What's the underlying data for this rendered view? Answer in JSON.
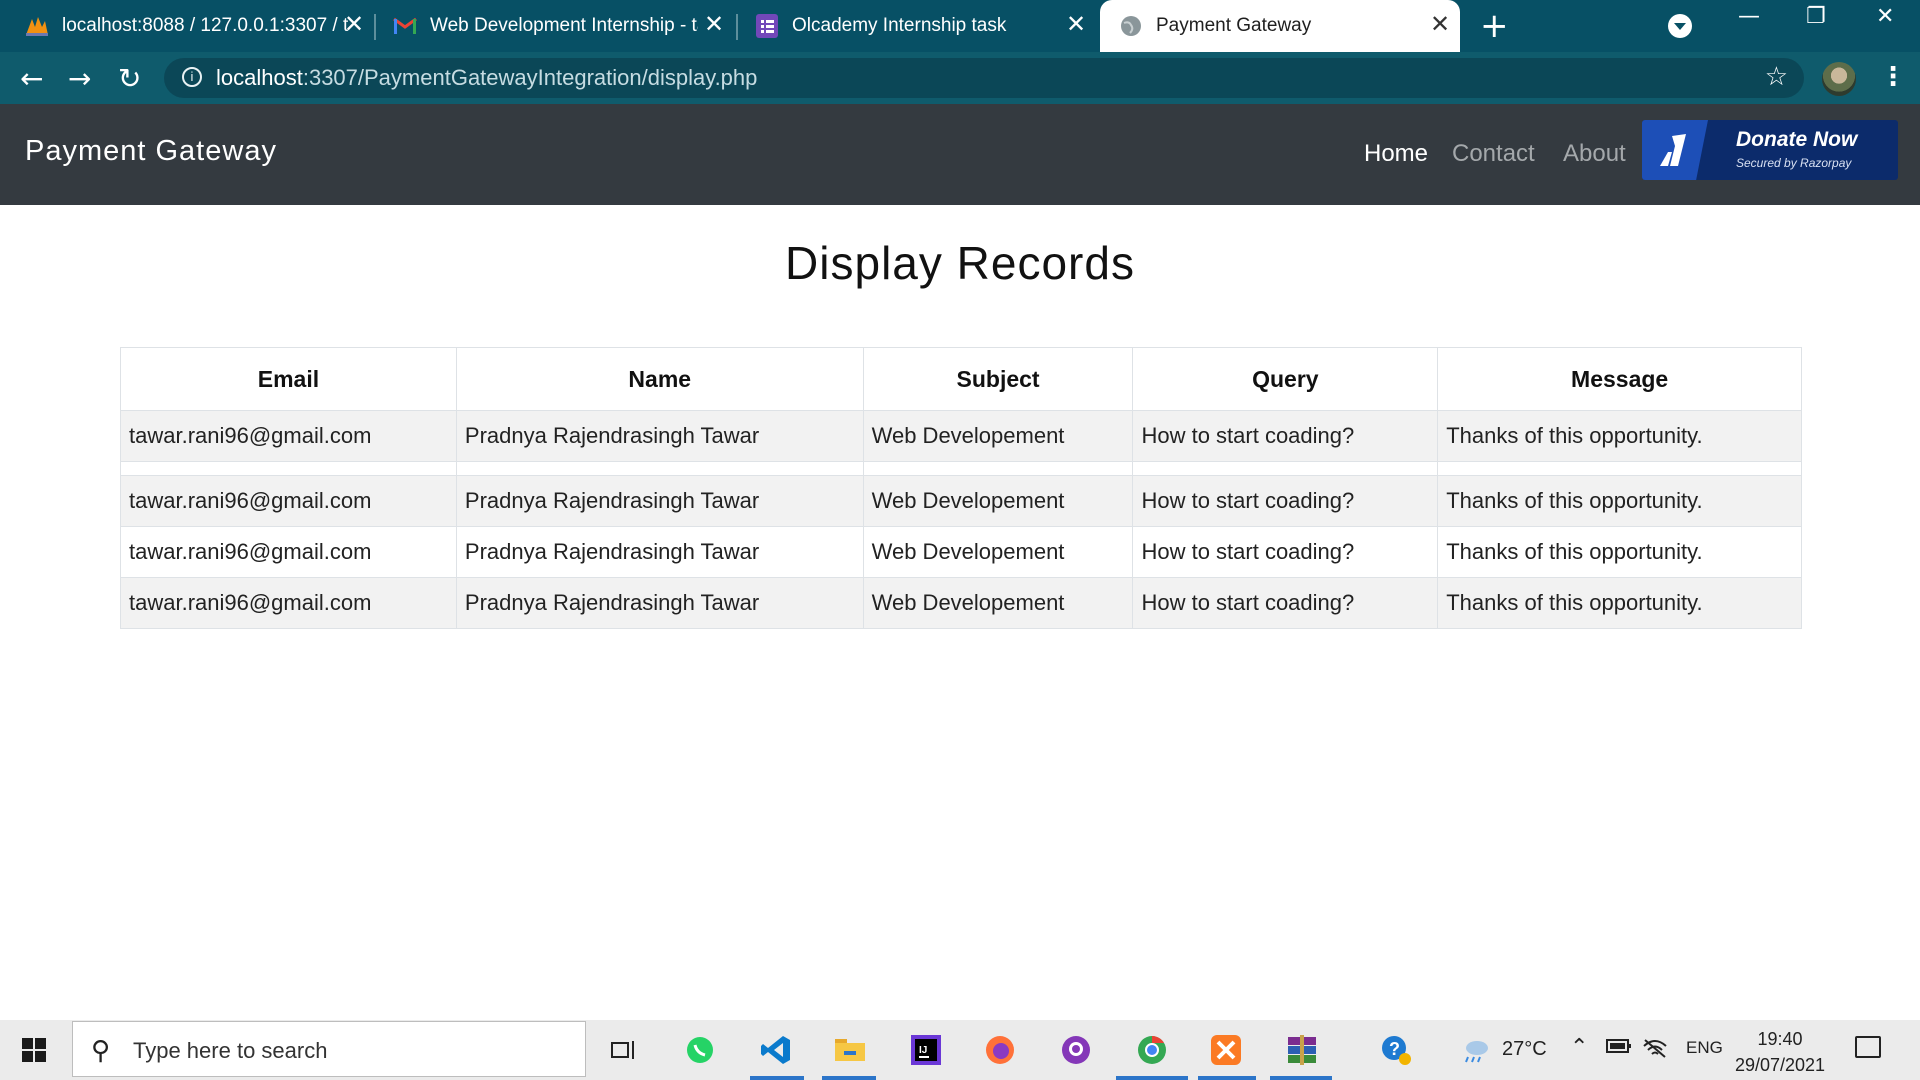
{
  "browser": {
    "tabs": [
      {
        "title": "localhost:8088 / 127.0.0.1:3307 / t",
        "icon": "phpmyadmin-icon",
        "active": false
      },
      {
        "title": "Web Development Internship - ta",
        "icon": "gmail-icon",
        "active": false
      },
      {
        "title": "Olcademy Internship task",
        "icon": "forms-icon",
        "active": false
      },
      {
        "title": "Payment Gateway",
        "icon": "globe-icon",
        "active": true
      }
    ],
    "address": {
      "host": "localhost",
      "path": ":3307/PaymentGatewayIntegration/display.php"
    }
  },
  "navbar": {
    "brand": "Payment Gateway",
    "links": [
      {
        "label": "Home",
        "active": true
      },
      {
        "label": "Contact",
        "active": false
      },
      {
        "label": "About",
        "active": false
      }
    ],
    "donate": {
      "label": "Donate Now",
      "sub": "Secured by Razorpay"
    }
  },
  "page": {
    "title": "Display Records",
    "table": {
      "headers": [
        "Email",
        "Name",
        "Subject",
        "Query",
        "Message"
      ],
      "rows": [
        [
          "tawar.rani96@gmail.com",
          "Pradnya Rajendrasingh Tawar",
          "Web Developement",
          "How to start coading?",
          "Thanks of this opportunity."
        ],
        [
          "",
          "",
          "",
          "",
          ""
        ],
        [
          "tawar.rani96@gmail.com",
          "Pradnya Rajendrasingh Tawar",
          "Web Developement",
          "How to start coading?",
          "Thanks of this opportunity."
        ],
        [
          "tawar.rani96@gmail.com",
          "Pradnya Rajendrasingh Tawar",
          "Web Developement",
          "How to start coading?",
          "Thanks of this opportunity."
        ],
        [
          "tawar.rani96@gmail.com",
          "Pradnya Rajendrasingh Tawar",
          "Web Developement",
          "How to start coading?",
          "Thanks of this opportunity."
        ]
      ]
    }
  },
  "taskbar": {
    "search_placeholder": "Type here to search",
    "weather": "27°C",
    "language": "ENG",
    "time": "19:40",
    "date": "29/07/2021"
  },
  "colors": {
    "tabbar": "#075065",
    "navbar": "#343a40",
    "donate": "#0c2b6b"
  }
}
